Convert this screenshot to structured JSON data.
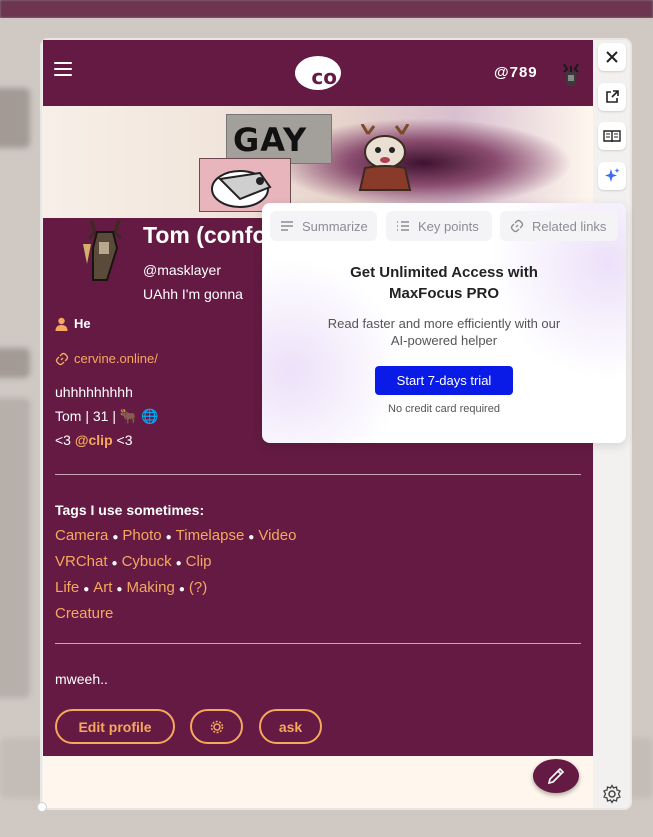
{
  "header": {
    "handle": "@789",
    "logo_text": "co"
  },
  "banner": {
    "sticker_text": "GAY"
  },
  "profile": {
    "name": "Tom (confo",
    "handle": "@masklayer",
    "bio_preview": "UAhh I'm gonna",
    "pronoun": "He",
    "website": "cervine.online/",
    "desc_line1": "uhhhhhhhhh",
    "desc_line2_text": "Tom | 31 | ",
    "desc_line2_emoji": "🐂 🌐",
    "desc_line3_pre": "<3 ",
    "desc_line3_mention": "@clip",
    "desc_line3_post": " <3",
    "tags_title": "Tags I use sometimes:",
    "tags_rows": [
      [
        "Camera",
        "Photo",
        "Timelapse",
        "Video"
      ],
      [
        "VRChat",
        "Cybuck",
        "Clip"
      ],
      [
        "Life",
        "Art",
        "Making",
        "(?)"
      ],
      [
        "Creature"
      ]
    ],
    "footer_text": "mweeh..",
    "buttons": {
      "edit": "Edit profile",
      "ask": "ask"
    }
  },
  "popup": {
    "tabs": [
      "Summarize",
      "Key points",
      "Related links"
    ],
    "title_line1": "Get Unlimited Access with",
    "title_line2": "MaxFocus PRO",
    "subtitle_line1": "Read faster and more efficiently with our",
    "subtitle_line2": "AI-powered helper",
    "cta": "Start 7-days trial",
    "note": "No credit card required"
  },
  "colors": {
    "brand": "#641a42",
    "accent": "#f6a85e",
    "cta": "#0a1be8"
  },
  "icons": [
    "menu-icon",
    "close-icon",
    "external-link-icon",
    "reader-icon",
    "sparkle-icon",
    "settings-icon",
    "pencil-icon",
    "gear-icon",
    "link-icon",
    "person-icon"
  ]
}
